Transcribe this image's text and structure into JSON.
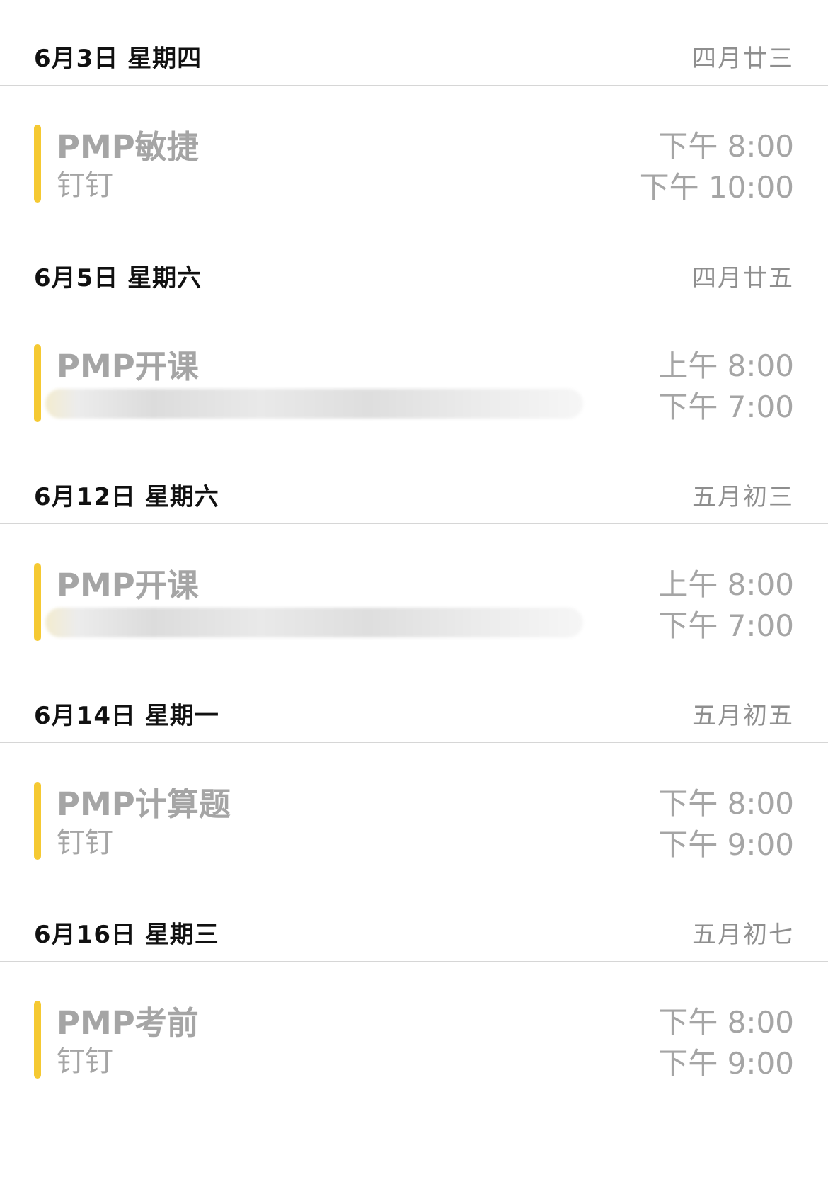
{
  "agenda": [
    {
      "date": "6月3日 星期四",
      "lunar": "四月廿三",
      "event": {
        "title": "PMP敏捷",
        "subtitle": "钉钉",
        "start": "下午 8:00",
        "end": "下午 10:00",
        "subtitle_redacted": false
      }
    },
    {
      "date": "6月5日 星期六",
      "lunar": "四月廿五",
      "event": {
        "title": "PMP开课",
        "subtitle": "",
        "start": "上午 8:00",
        "end": "下午 7:00",
        "subtitle_redacted": true
      }
    },
    {
      "date": "6月12日 星期六",
      "lunar": "五月初三",
      "event": {
        "title": "PMP开课",
        "subtitle": "",
        "start": "上午 8:00",
        "end": "下午 7:00",
        "subtitle_redacted": true
      }
    },
    {
      "date": "6月14日 星期一",
      "lunar": "五月初五",
      "event": {
        "title": "PMP计算题",
        "subtitle": "钉钉",
        "start": "下午 8:00",
        "end": "下午 9:00",
        "subtitle_redacted": false
      }
    },
    {
      "date": "6月16日 星期三",
      "lunar": "五月初七",
      "event": {
        "title": "PMP考前",
        "subtitle": "钉钉",
        "start": "下午 8:00",
        "end": "下午 9:00",
        "subtitle_redacted": false
      }
    }
  ],
  "colors": {
    "event_bar": "#f5c932",
    "date_text": "#111111",
    "secondary_text": "#8e8e8e",
    "event_text": "#a5a5a5",
    "divider": "#d6d6d6"
  }
}
